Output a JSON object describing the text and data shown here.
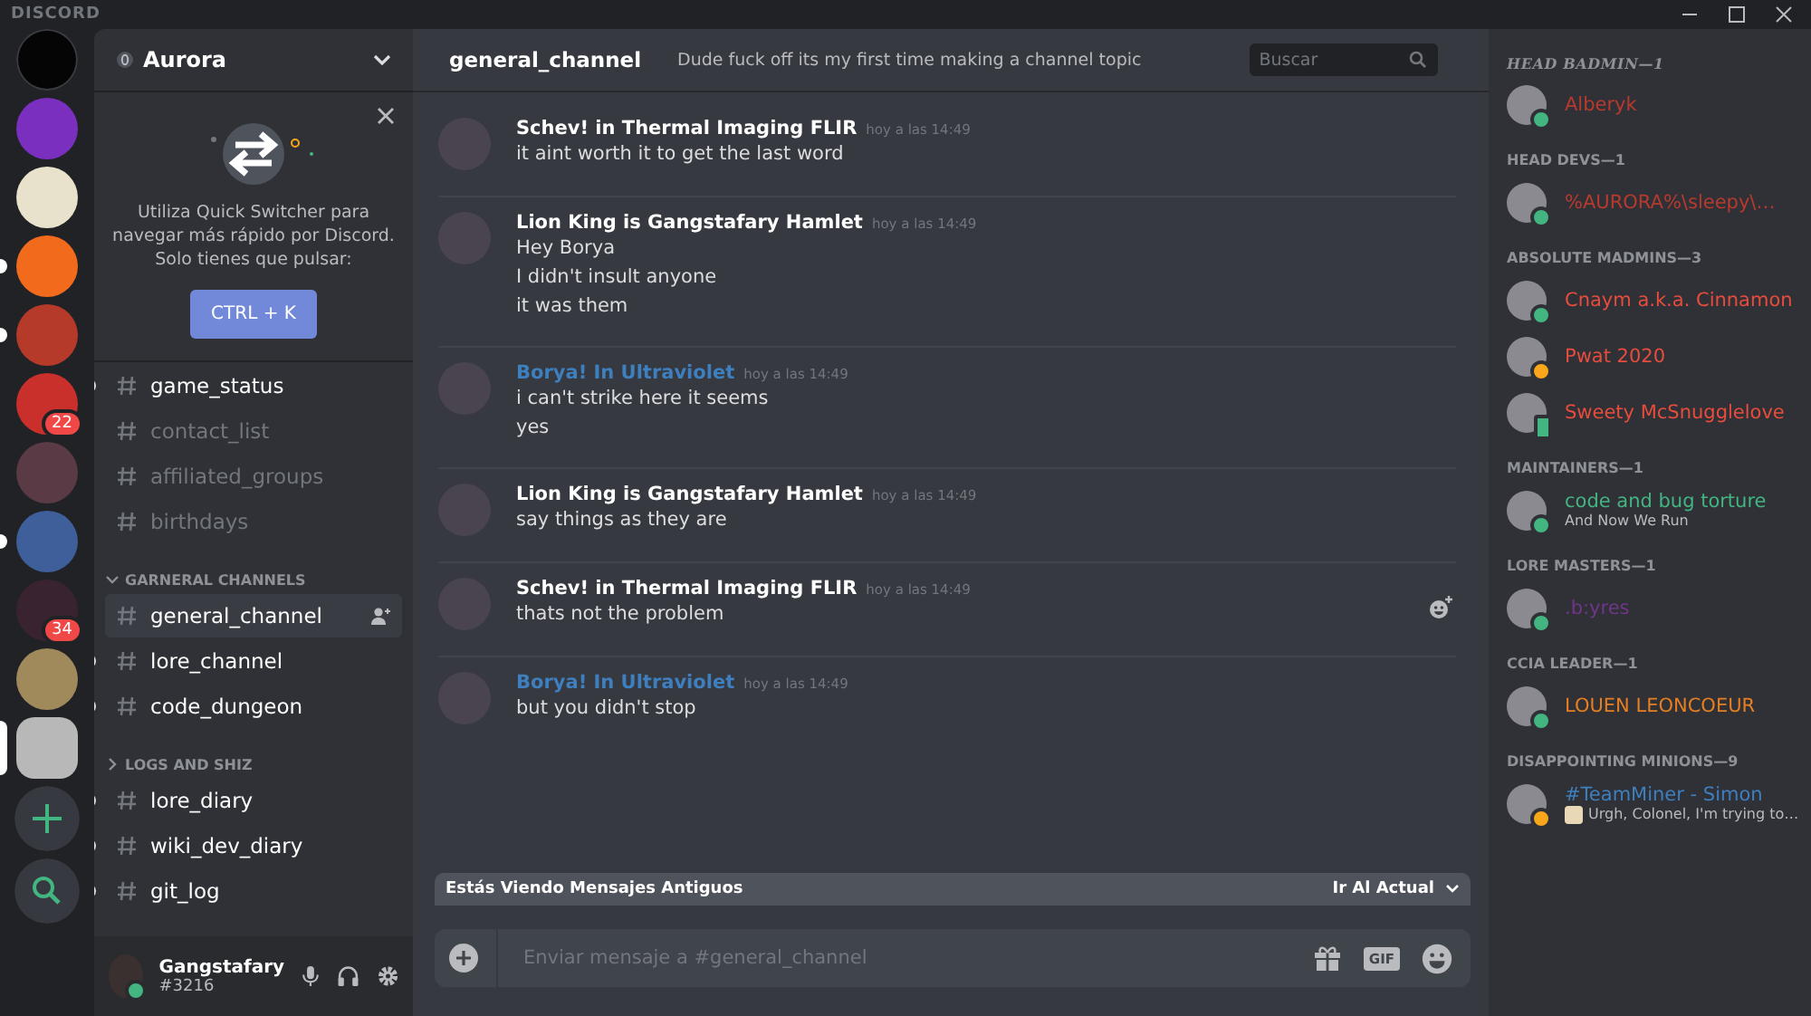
{
  "titlebar": {
    "brand": "DISCORD"
  },
  "servers": [
    {
      "color": "#050505"
    },
    {
      "color": "#7b2fbf"
    },
    {
      "color": "#e8e2cc"
    },
    {
      "color": "#f26b1d",
      "unread": true
    },
    {
      "color": "#b53a2a",
      "unread": true
    },
    {
      "color": "#c9302c",
      "badge": "22"
    },
    {
      "color": "#5a3a44"
    },
    {
      "color": "#3f5f9a",
      "unread": true
    },
    {
      "color": "#3a2330",
      "badge": "34"
    },
    {
      "color": "#a08a5c"
    },
    {
      "color": "#b8b8b8",
      "selected": true
    }
  ],
  "server": {
    "name": "Aurora"
  },
  "switcher": {
    "text": "Utiliza Quick Switcher para navegar más rápido por Discord. Solo tienes que pulsar:",
    "button": "CTRL + K"
  },
  "channels": [
    {
      "kind": "channel",
      "name": "game_status",
      "unread": true,
      "selected": false
    },
    {
      "kind": "channel",
      "name": "contact_list",
      "unread": false,
      "selected": false
    },
    {
      "kind": "channel",
      "name": "affiliated_groups",
      "unread": false,
      "selected": false
    },
    {
      "kind": "channel",
      "name": "birthdays",
      "unread": false,
      "selected": false
    },
    {
      "kind": "category",
      "name": "GARNERAL CHANNELS",
      "expanded": true
    },
    {
      "kind": "channel",
      "name": "general_channel",
      "unread": true,
      "selected": true
    },
    {
      "kind": "channel",
      "name": "lore_channel",
      "unread": true,
      "selected": false
    },
    {
      "kind": "channel",
      "name": "code_dungeon",
      "unread": true,
      "selected": false
    },
    {
      "kind": "category",
      "name": "LOGS AND SHIZ",
      "expanded": false
    },
    {
      "kind": "channel",
      "name": "lore_diary",
      "unread": true,
      "selected": false
    },
    {
      "kind": "channel",
      "name": "wiki_dev_diary",
      "unread": true,
      "selected": false
    },
    {
      "kind": "channel",
      "name": "git_log",
      "unread": true,
      "selected": false
    }
  ],
  "user": {
    "name": "Gangstafary",
    "tag": "#3216"
  },
  "header": {
    "channel": "general_channel",
    "topic": "Dude fuck off its my first time making a channel topic",
    "search": {
      "placeholder": "Buscar"
    }
  },
  "messages": [
    {
      "author": "Schev! in Thermal Imaging FLIR",
      "color": "#ffffff",
      "time": "hoy a las 14:49",
      "lines": [
        "it aint worth it to get the last word"
      ]
    },
    {
      "author": "Lion King is Gangstafary Hamlet",
      "color": "#ffffff",
      "time": "hoy a las 14:49",
      "lines": [
        "Hey Borya",
        "I didn't insult anyone",
        "it was them"
      ]
    },
    {
      "author": "Borya! In Ultraviolet",
      "color": "#3e7fbf",
      "time": "hoy a las 14:49",
      "lines": [
        "i can't strike here it seems",
        "yes"
      ]
    },
    {
      "author": "Lion King is Gangstafary Hamlet",
      "color": "#ffffff",
      "time": "hoy a las 14:49",
      "lines": [
        "say things as they are"
      ]
    },
    {
      "author": "Schev! in Thermal Imaging FLIR",
      "color": "#ffffff",
      "time": "hoy a las 14:49",
      "lines": [
        "thats not the problem"
      ],
      "hovered": true
    },
    {
      "author": "Borya! In Ultraviolet",
      "color": "#3e7fbf",
      "time": "hoy a las 14:49",
      "lines": [
        "but you didn't stop"
      ]
    }
  ],
  "old_bar": {
    "text": "Estás Viendo Mensajes Antiguos",
    "action": "Ir Al Actual"
  },
  "composer": {
    "placeholder": "Enviar mensaje a #general_channel",
    "gif": "GIF"
  },
  "member_groups": [
    {
      "title": "HEAD BADMIN—1",
      "fancy": true,
      "members": [
        {
          "name": "Alberyk",
          "color": "#b83a2e",
          "status": {
            "color": "#43b581",
            "mobile": false
          }
        }
      ]
    },
    {
      "title": "HEAD DEVS—1",
      "fancy": false,
      "members": [
        {
          "name": "%AURORA%\\sleepy\\…",
          "color": "#b83a2e",
          "status": {
            "color": "#43b581",
            "mobile": false
          }
        }
      ]
    },
    {
      "title": "ABSOLUTE MADMINS—3",
      "fancy": false,
      "members": [
        {
          "name": "Cnaym a.k.a. Cinnamon",
          "color": "#e84c3d",
          "status": {
            "color": "#43b581",
            "mobile": false
          }
        },
        {
          "name": "Pwat 2020",
          "color": "#e84c3d",
          "status": {
            "color": "#faa61a",
            "mobile": false
          }
        },
        {
          "name": "Sweety McSnugglelove",
          "color": "#e84c3d",
          "status": {
            "color": "#43b581",
            "mobile": true
          }
        }
      ]
    },
    {
      "title": "MAINTAINERS—1",
      "fancy": false,
      "members": [
        {
          "name": "code and bug torture",
          "color": "#43b581",
          "status": {
            "color": "#43b581",
            "mobile": false
          },
          "activity": "And Now We Run"
        }
      ]
    },
    {
      "title": "LORE MASTERS—1",
      "fancy": false,
      "members": [
        {
          "name": ".b:yres",
          "color": "#71368a",
          "status": {
            "color": "#43b581",
            "mobile": false
          }
        }
      ]
    },
    {
      "title": "CCIA LEADER—1",
      "fancy": false,
      "members": [
        {
          "name": "LOUEN LEONCOEUR",
          "color": "#e67e22",
          "status": {
            "color": "#43b581",
            "mobile": false
          }
        }
      ]
    },
    {
      "title": "DISAPPOINTING MINIONS—9",
      "fancy": false,
      "members": [
        {
          "name": "#TeamMiner - Simon",
          "color": "#3e7fbf",
          "status": {
            "color": "#faa61a",
            "mobile": false
          },
          "activity": "Urgh, Colonel, I'm trying to…",
          "activity_icon": true
        }
      ]
    }
  ]
}
